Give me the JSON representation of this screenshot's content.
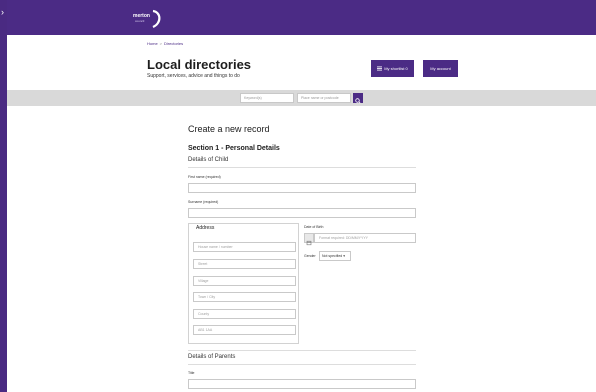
{
  "header": {
    "logo_word": "merton",
    "logo_sub": "council"
  },
  "breadcrumb": {
    "home": "Home",
    "separator": ">",
    "current": "Directories"
  },
  "page": {
    "title": "Local directories",
    "subtitle": "Support, services, advice and things to do"
  },
  "actions": {
    "shortlist_label": "My shortlist 0",
    "account_label": "My account"
  },
  "search": {
    "keyword_placeholder": "Keyword(s)",
    "place_placeholder": "Place name or postcode"
  },
  "form": {
    "title": "Create a new record",
    "section1_title": "Section 1 - Personal Details",
    "child_heading": "Details of Child",
    "first_name_label": "First name (required)",
    "surname_label": "Surname (required)",
    "address_legend": "Address",
    "address_placeholders": {
      "house": "House name / number",
      "street": "Street",
      "village": "Village",
      "town": "Town / City",
      "county": "County",
      "postcode": "AB1 1AA"
    },
    "dob_label": "Date of Birth",
    "dob_placeholder": "Format required: DD/MM/YYYY",
    "gender_label": "Gender",
    "gender_selected": "Not specified",
    "parents_heading": "Details of Parents",
    "title_label": "Title"
  },
  "colors": {
    "brand": "#4b2b85",
    "search_bar": "#d9d9d9"
  }
}
